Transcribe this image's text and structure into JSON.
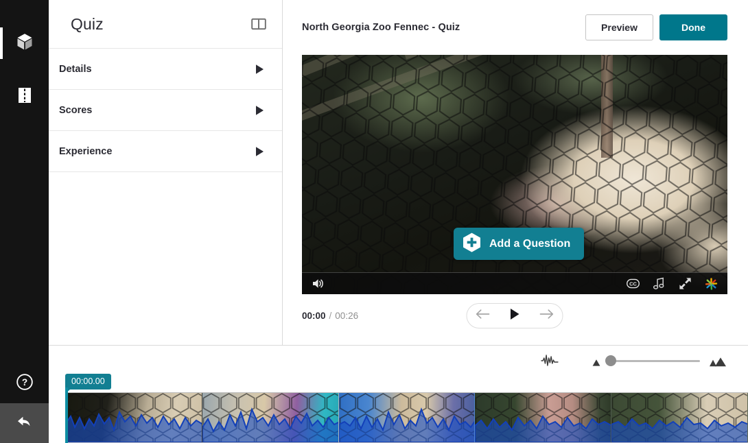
{
  "rail": {
    "items": [
      {
        "name": "media-cube",
        "icon": "cube-icon",
        "active": true
      },
      {
        "name": "timeline-split",
        "icon": "film-split-icon",
        "active": false
      }
    ],
    "help_icon": "help-circle-icon",
    "back_icon": "back-arrow-icon"
  },
  "panel": {
    "title": "Quiz",
    "toggle_icon": "panel-layout-icon",
    "rows": [
      {
        "label": "Details",
        "arrow": "play-triangle-icon"
      },
      {
        "label": "Scores",
        "arrow": "play-triangle-icon"
      },
      {
        "label": "Experience",
        "arrow": "play-triangle-icon"
      }
    ]
  },
  "main": {
    "title": "North Georgia Zoo Fennec - Quiz",
    "preview_label": "Preview",
    "done_label": "Done",
    "accent_teal": "#00778b",
    "button_teal": "#127f92"
  },
  "video": {
    "add_question_label": "Add a Question",
    "add_question_icon": "hexagon-plus-icon",
    "controls": {
      "volume_icon": "volume-on-icon",
      "cc_icon": "closed-caption-icon",
      "audio_track_icon": "music-note-icon",
      "fullscreen_icon": "expand-fullscreen-icon",
      "brand_icon": "kaltura-starburst-icon"
    }
  },
  "transport": {
    "current_time": "00:00",
    "separator": "/",
    "total_time": "00:26",
    "prev_icon": "arrow-left-icon",
    "play_icon": "play-icon",
    "next_icon": "arrow-right-icon"
  },
  "timeline": {
    "waveform_icon": "audio-waveform-icon",
    "zoom_out_icon": "zoom-out-mountain-icon",
    "zoom_in_icon": "zoom-in-mountains-icon",
    "zoom_value": 0,
    "playhead_time": "00:00.00",
    "frames": [
      {
        "index": 0
      },
      {
        "index": 1
      },
      {
        "index": 2
      },
      {
        "index": 3
      },
      {
        "index": 4
      }
    ]
  }
}
